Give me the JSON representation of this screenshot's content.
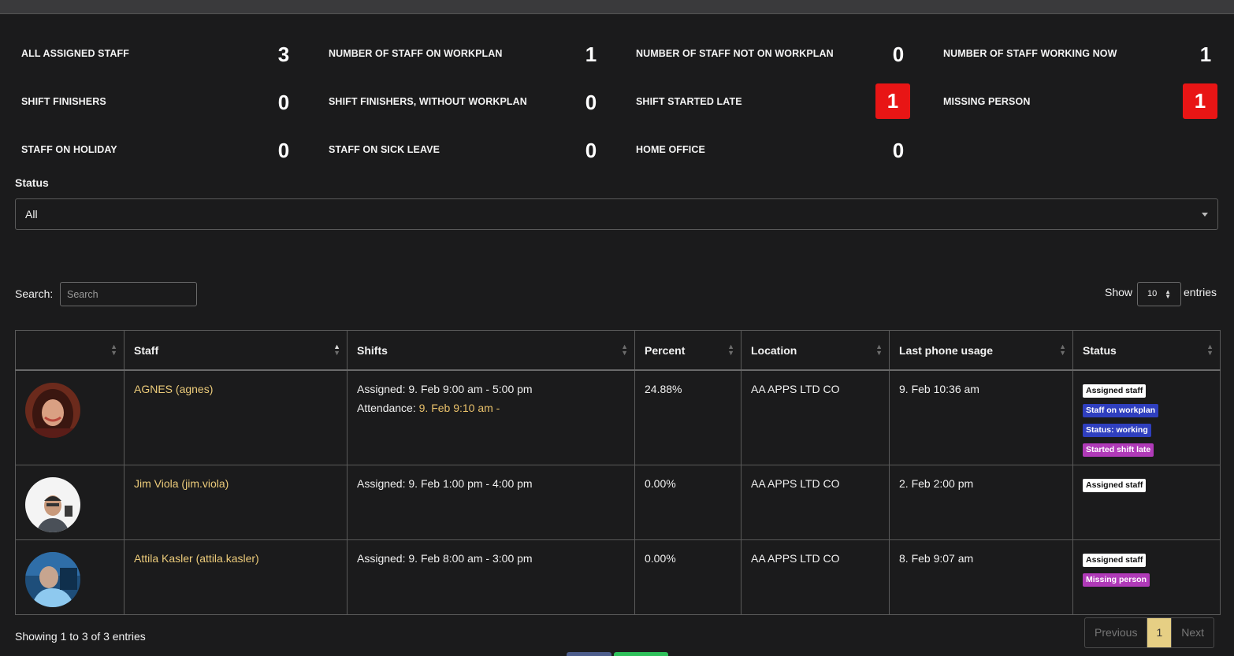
{
  "stats": [
    {
      "label": "ALL ASSIGNED STAFF",
      "value": "3",
      "alert": false
    },
    {
      "label": "NUMBER OF STAFF ON WORKPLAN",
      "value": "1",
      "alert": false
    },
    {
      "label": "NUMBER OF STAFF NOT ON WORKPLAN",
      "value": "0",
      "alert": false
    },
    {
      "label": "NUMBER OF STAFF WORKING NOW",
      "value": "1",
      "alert": false
    },
    {
      "label": "SHIFT FINISHERS",
      "value": "0",
      "alert": false
    },
    {
      "label": "SHIFT FINISHERS, WITHOUT WORKPLAN",
      "value": "0",
      "alert": false
    },
    {
      "label": "SHIFT STARTED LATE",
      "value": "1",
      "alert": true
    },
    {
      "label": "MISSING PERSON",
      "value": "1",
      "alert": true
    },
    {
      "label": "STAFF ON HOLIDAY",
      "value": "0",
      "alert": false
    },
    {
      "label": "STAFF ON SICK LEAVE",
      "value": "0",
      "alert": false
    },
    {
      "label": "HOME OFFICE",
      "value": "0",
      "alert": false
    }
  ],
  "alert_color": "#e81515",
  "status_filter": {
    "label": "Status",
    "value": "All"
  },
  "search": {
    "label": "Search:",
    "placeholder": "Search",
    "value": ""
  },
  "page_length": {
    "show_label": "Show",
    "value": "10",
    "entries_label": "entries"
  },
  "table": {
    "headers": [
      "",
      "Staff",
      "Shifts",
      "Percent",
      "Location",
      "Last phone usage",
      "Status"
    ],
    "rows": [
      {
        "avatar": "avatar-agnes",
        "staff": "AGNES (agnes)",
        "shift_assigned": "Assigned: 9. Feb 9:00 am - 5:00 pm",
        "attendance_label": "Attendance: ",
        "attendance_value": "9. Feb 9:10 am -",
        "percent": "24.88%",
        "location": "AA APPS LTD CO",
        "last_phone": "9. Feb 10:36 am",
        "badges": [
          "Assigned staff",
          "Staff on workplan",
          "Status: working",
          "Started shift late"
        ]
      },
      {
        "avatar": "avatar-jim",
        "staff": "Jim Viola (jim.viola)",
        "shift_assigned": "Assigned: 9. Feb 1:00 pm - 4:00 pm",
        "percent": "0.00%",
        "location": "AA APPS LTD CO",
        "last_phone": "2. Feb 2:00 pm",
        "badges": [
          "Assigned staff"
        ]
      },
      {
        "avatar": "avatar-attila",
        "staff": "Attila Kasler (attila.kasler)",
        "shift_assigned": "Assigned: 9. Feb 8:00 am - 3:00 pm",
        "percent": "0.00%",
        "location": "AA APPS LTD CO",
        "last_phone": "8. Feb 9:07 am",
        "badges": [
          "Assigned staff",
          "Missing person"
        ]
      }
    ]
  },
  "footer": {
    "info": "Showing 1 to 3 of 3 entries"
  },
  "pagination": {
    "previous": "Previous",
    "current": "1",
    "next": "Next"
  },
  "colors": {
    "link": "#eccb7a",
    "badge_blue": "#2f3fbf",
    "badge_purple": "#b03ab8",
    "pager_active": "#e6cf84"
  }
}
